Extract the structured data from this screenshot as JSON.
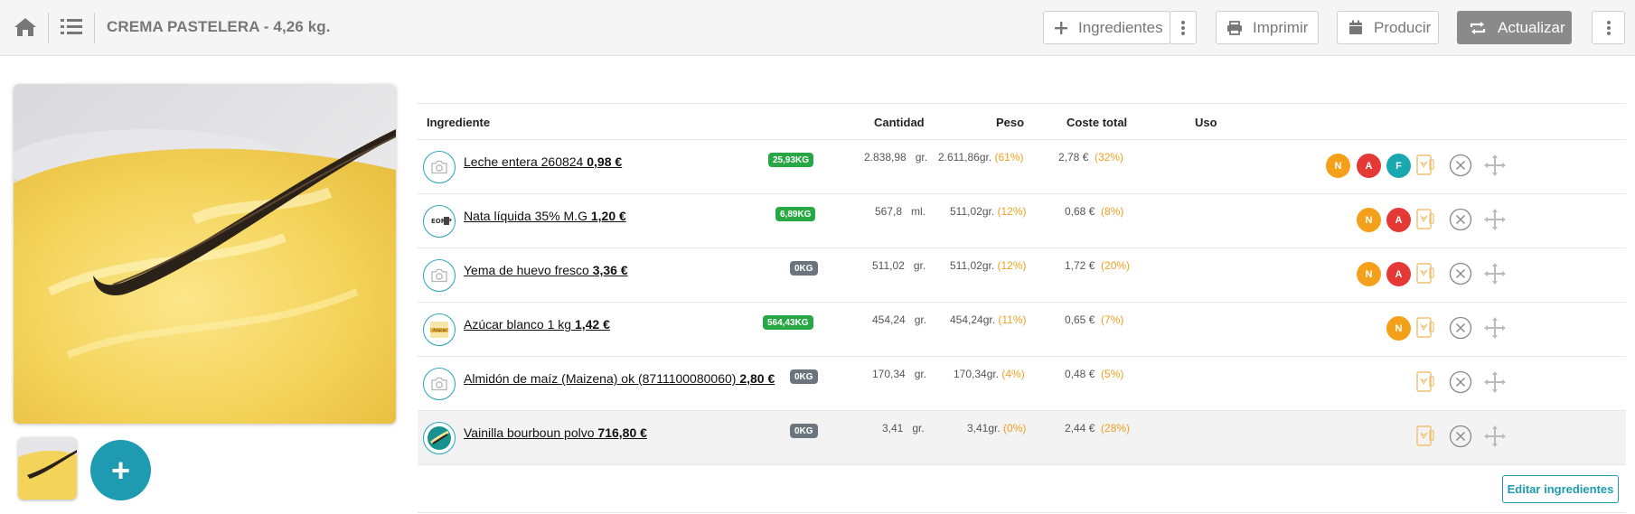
{
  "header": {
    "title": "CREMA PASTELERA - 4,26 kg.",
    "home_icon": "home-icon",
    "list_icon": "list-icon",
    "buttons": {
      "ingredientes": "Ingredientes",
      "imprimir": "Imprimir",
      "producir": "Producir",
      "actualizar": "Actualizar"
    }
  },
  "photo": {
    "add_label": "+"
  },
  "table": {
    "columns": {
      "ingrediente": "Ingrediente",
      "cantidad": "Cantidad",
      "peso": "Peso",
      "coste": "Coste total",
      "uso": "Uso"
    },
    "rows": [
      {
        "name": "Leche entera 260824",
        "price": "0,98 €",
        "stock": "25,93KG",
        "stock_color": "green",
        "qty": "2.838,98",
        "unit": "gr.",
        "peso": "2.611,86gr.",
        "peso_pct": "(61%)",
        "coste": "2,78 €",
        "coste_pct": "(32%)",
        "badges": [
          "N",
          "A",
          "F"
        ],
        "image": "camera"
      },
      {
        "name": "Nata líquida 35% M.G",
        "price": "1,20 €",
        "stock": "6,89KG",
        "stock_color": "green",
        "qty": "567,8",
        "unit": "ml.",
        "peso": "511,02gr.",
        "peso_pct": "(12%)",
        "coste": "0,68 €",
        "coste_pct": "(8%)",
        "badges": [
          "N",
          "A"
        ],
        "image": "cream"
      },
      {
        "name": "Yema de huevo fresco",
        "price": "3,36 €",
        "stock": "0KG",
        "stock_color": "grey",
        "qty": "511,02",
        "unit": "gr.",
        "peso": "511,02gr.",
        "peso_pct": "(12%)",
        "coste": "1,72 €",
        "coste_pct": "(20%)",
        "badges": [
          "N",
          "A"
        ],
        "image": "camera"
      },
      {
        "name": "Azúcar blanco 1 kg",
        "price": "1,42 €",
        "stock": "564,43KG",
        "stock_color": "green",
        "qty": "454,24",
        "unit": "gr.",
        "peso": "454,24gr.",
        "peso_pct": "(11%)",
        "coste": "0,65 €",
        "coste_pct": "(7%)",
        "badges": [
          "N"
        ],
        "image": "sugar"
      },
      {
        "name": "Almidón de maíz (Maizena) ok (8711100080060)",
        "price": "2,80 €",
        "stock": "0KG",
        "stock_color": "grey",
        "qty": "170,34",
        "unit": "gr.",
        "peso": "170,34gr.",
        "peso_pct": "(4%)",
        "coste": "0,48 €",
        "coste_pct": "(5%)",
        "badges": [],
        "image": "camera"
      },
      {
        "name": "Vainilla bourboun polvo",
        "price": "716,80 €",
        "stock": "0KG",
        "stock_color": "grey",
        "qty": "3,41",
        "unit": "gr.",
        "peso": "3,41gr.",
        "peso_pct": "(0%)",
        "coste": "2,44 €",
        "coste_pct": "(28%)",
        "badges": [],
        "image": "vanilla"
      }
    ],
    "edit_label": "Editar ingredientes"
  },
  "colors": {
    "accent": "#1e9bb0",
    "badge_N": "#f5a01a",
    "badge_A": "#e53935",
    "badge_F": "#1aa8b0",
    "stock_green": "#28a745",
    "stock_grey": "#6c757d",
    "pct": "#f0a020"
  }
}
